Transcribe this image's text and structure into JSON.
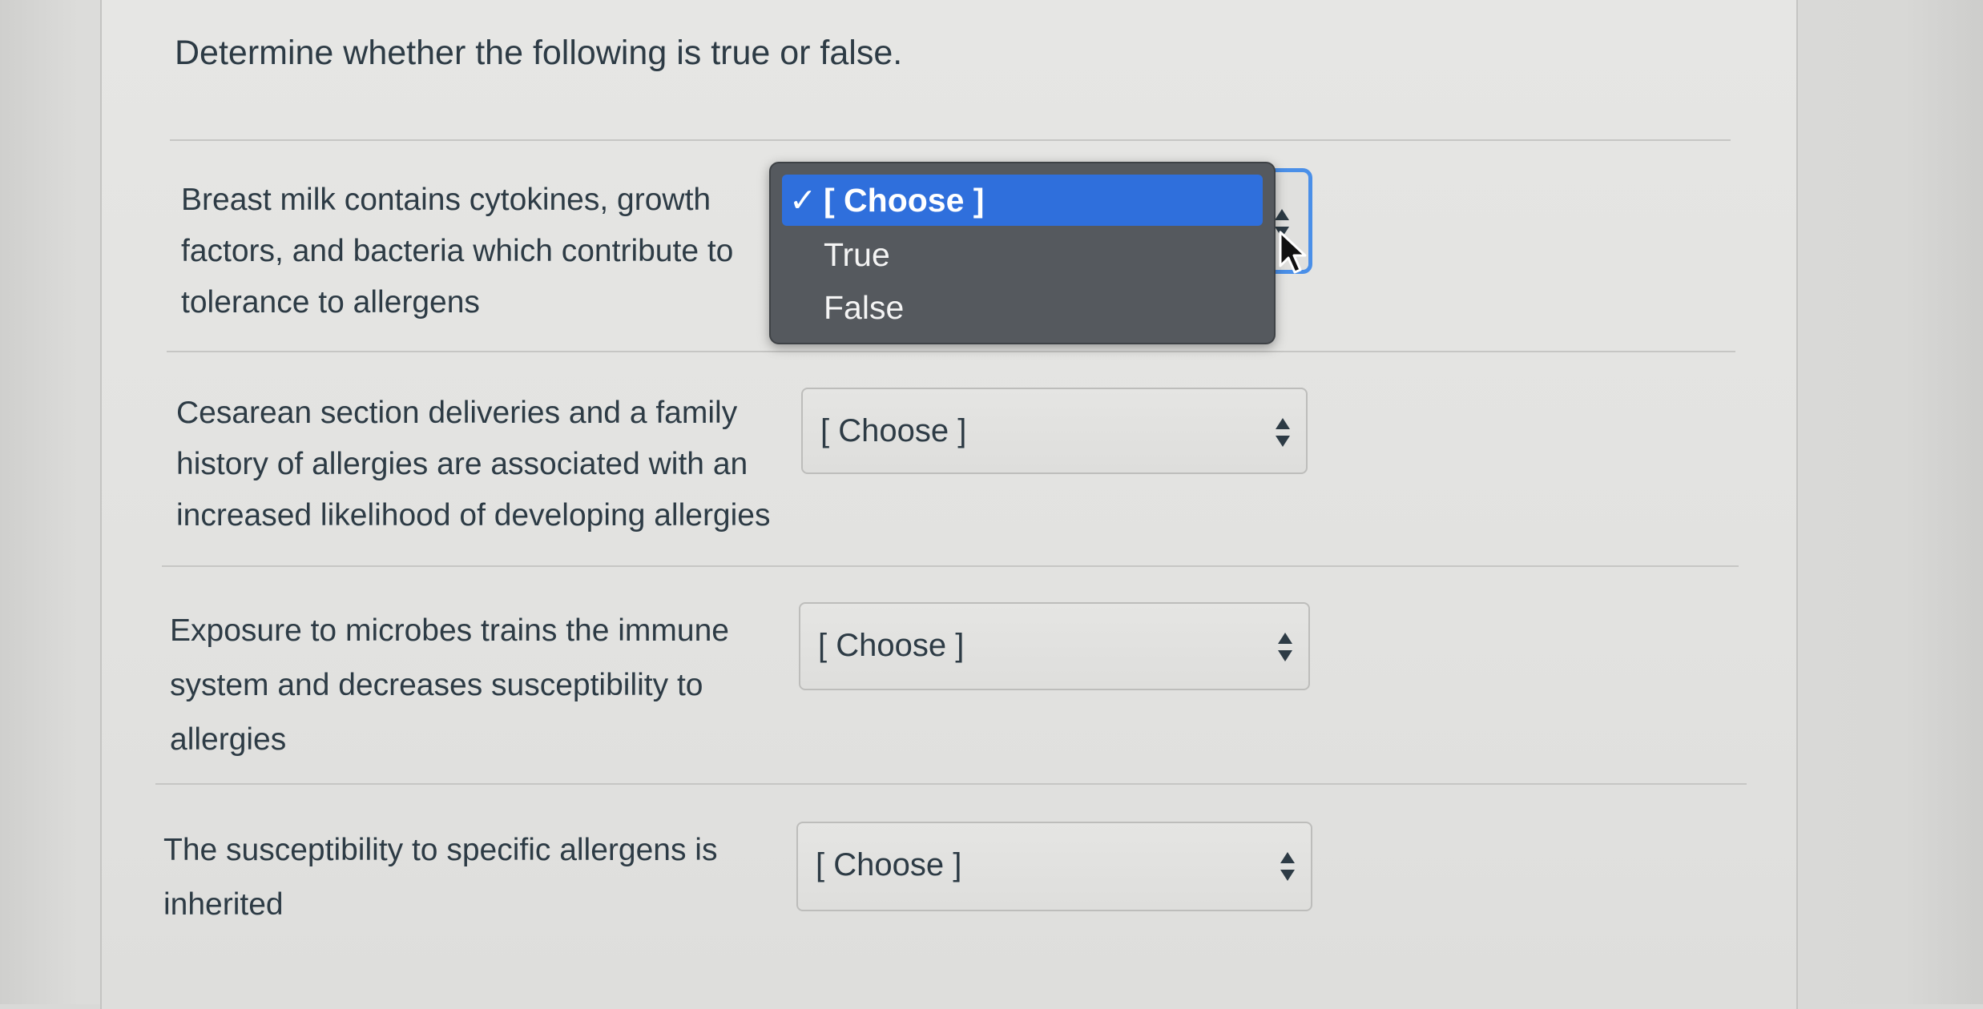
{
  "title": "Determine whether the following is true or false.",
  "questions": [
    {
      "statement_lines": [
        "Breast milk contains cytokines, growth",
        "factors, and bacteria which contribute to",
        "tolerance to allergens"
      ],
      "selected": "[ Choose ]"
    },
    {
      "statement_lines": [
        "Cesarean section deliveries and a family",
        "history of allergies are associated with an",
        "increased likelihood of developing allergies"
      ],
      "selected": "[ Choose ]"
    },
    {
      "statement_lines": [
        "Exposure to microbes trains the immune",
        "system and decreases susceptibility to",
        "allergies"
      ],
      "selected": "[ Choose ]"
    },
    {
      "statement_lines": [
        "The susceptibility to specific allergens is",
        "inherited"
      ],
      "selected": "[ Choose ]"
    }
  ],
  "dropdown_popup": {
    "options": [
      {
        "check": "✓",
        "label": "[ Choose ]"
      },
      {
        "label": "True"
      },
      {
        "label": "False"
      }
    ]
  },
  "icons": {
    "select_arrows": "up-down-arrows-icon",
    "cursor": "mouse-pointer-icon"
  },
  "colors": {
    "highlight": "#2f6fdc",
    "focus_ring": "#4a8fe8",
    "popup_bg": "#55595e",
    "text": "#2d3b45"
  }
}
